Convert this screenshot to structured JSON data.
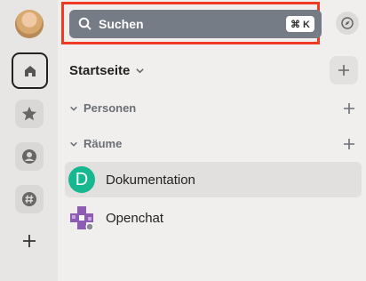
{
  "search": {
    "label": "Suchen",
    "shortcut": "⌘ K"
  },
  "home": {
    "title": "Startseite"
  },
  "sections": [
    {
      "label": "Personen"
    },
    {
      "label": "Räume"
    }
  ],
  "rooms": [
    {
      "name": "Dokumentation",
      "initial": "D",
      "color": "#17b890",
      "active": true
    },
    {
      "name": "Openchat",
      "initial": "",
      "color": "#8e5bb5",
      "active": false
    }
  ],
  "colors": {
    "search_bg": "#767c86",
    "highlight": "#ef3b23",
    "accent": "#17b890"
  }
}
